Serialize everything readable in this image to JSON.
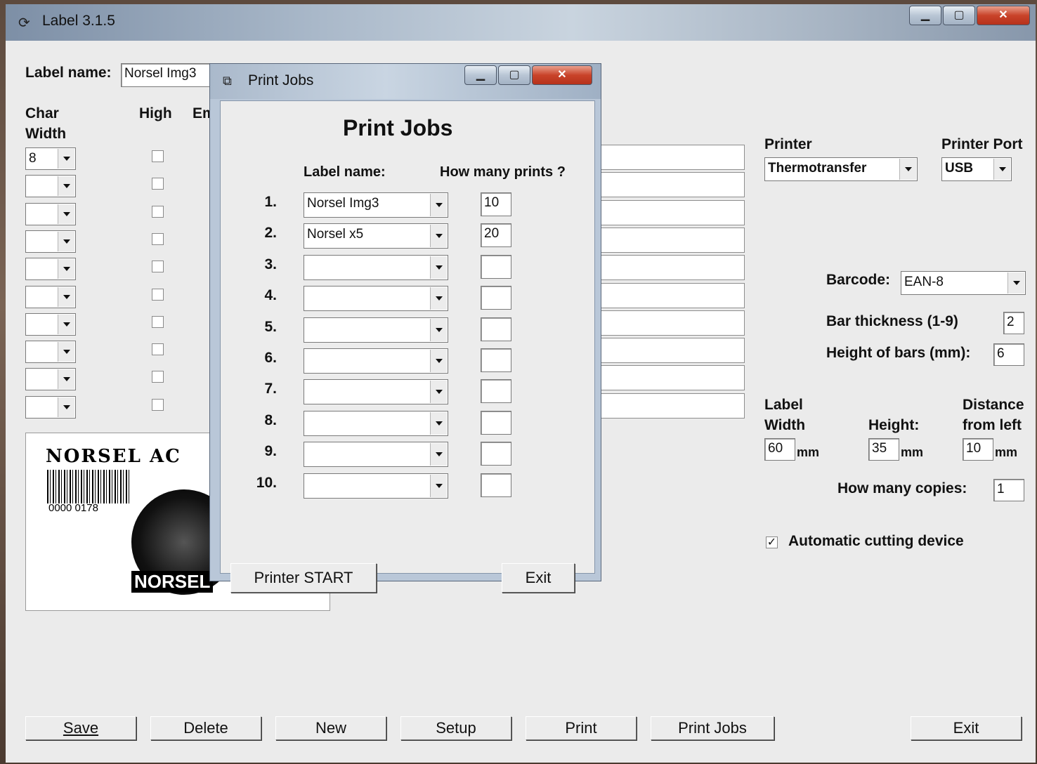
{
  "main_window": {
    "title": "Label 3.1.5",
    "label_name_label": "Label name:",
    "label_name_value": "Norsel Img3",
    "char_width_label_1": "Char",
    "char_width_label_2": "Width",
    "high_label": "High",
    "em_label": "Em",
    "char_width_rows": [
      "8",
      "",
      "",
      "",
      "",
      "",
      "",
      "",
      "",
      ""
    ],
    "printer_label": "Printer",
    "printer_value": "Thermotransfer",
    "printer_port_label": "Printer Port",
    "printer_port_value": "USB",
    "barcode_label": "Barcode:",
    "barcode_value": "EAN-8",
    "bar_thickness_label": "Bar thickness (1-9)",
    "bar_thickness_value": "2",
    "height_bars_label": "Height of bars (mm):",
    "height_bars_value": "6",
    "label_width_label_1": "Label",
    "label_width_label_2": "Width",
    "label_width_value": "60",
    "height_label": "Height:",
    "height_value": "35",
    "distance_label_1": "Distance",
    "distance_label_2": "from left",
    "distance_value": "10",
    "mm": "mm",
    "copies_label": "How many copies:",
    "copies_value": "1",
    "cutting_label": "Automatic cutting device",
    "cutting_checked": "✓",
    "preview": {
      "company_text": "NORSEL AC",
      "barcode_digits": "0000 0178",
      "logo_text": "NORSEL"
    },
    "buttons": {
      "save": "Save",
      "delete": "Delete",
      "new": "New",
      "setup": "Setup",
      "print": "Print",
      "print_jobs": "Print Jobs",
      "exit": "Exit"
    }
  },
  "dialog": {
    "title": "Print Jobs",
    "heading": "Print Jobs",
    "col_label_name": "Label name:",
    "col_prints": "How many prints ?",
    "jobs": [
      {
        "num": "1.",
        "label": "Norsel Img3",
        "prints": "10"
      },
      {
        "num": "2.",
        "label": "Norsel x5",
        "prints": "20"
      },
      {
        "num": "3.",
        "label": "",
        "prints": ""
      },
      {
        "num": "4.",
        "label": "",
        "prints": ""
      },
      {
        "num": "5.",
        "label": "",
        "prints": ""
      },
      {
        "num": "6.",
        "label": "",
        "prints": ""
      },
      {
        "num": "7.",
        "label": "",
        "prints": ""
      },
      {
        "num": "8.",
        "label": "",
        "prints": ""
      },
      {
        "num": "9.",
        "label": "",
        "prints": ""
      },
      {
        "num": "10.",
        "label": "",
        "prints": ""
      }
    ],
    "printer_start": "Printer START",
    "exit": "Exit"
  }
}
